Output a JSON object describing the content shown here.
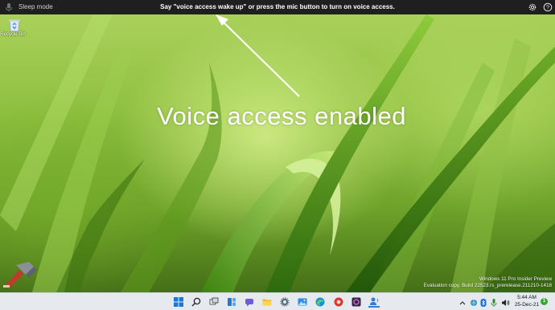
{
  "voice_access_bar": {
    "status": "Sleep mode",
    "message": "Say \"voice access wake up\" or press the mic button to turn on voice access."
  },
  "desktop": {
    "icons": [
      {
        "label": "Recycle Bin",
        "icon": "recycle-bin-icon"
      }
    ]
  },
  "overlay": {
    "caption": "Voice access enabled"
  },
  "watermark": {
    "line1": "Windows 11 Pro Insider Preview",
    "line2": "Evaluation copy. Build 22523.rs_prerelease.211210-1418"
  },
  "taskbar": {
    "apps": [
      "start-icon",
      "search-icon",
      "task-view-icon",
      "widgets-icon",
      "chat-icon",
      "file-explorer-icon",
      "settings-icon",
      "photos-icon",
      "edge-icon",
      "app-icon",
      "app-icon",
      "voice-access-icon"
    ],
    "tray_icons": [
      "chevron-up-icon",
      "network-icon",
      "bluetooth-icon",
      "microphone-icon",
      "volume-icon"
    ],
    "time": "5:44 AM",
    "date": "25-Dec-21",
    "notification_count": "1"
  },
  "colors": {
    "voice_bar_bg": "#1f1f1f",
    "taskbar_bg": "#e6eaee",
    "accent": "#3b78d8"
  }
}
